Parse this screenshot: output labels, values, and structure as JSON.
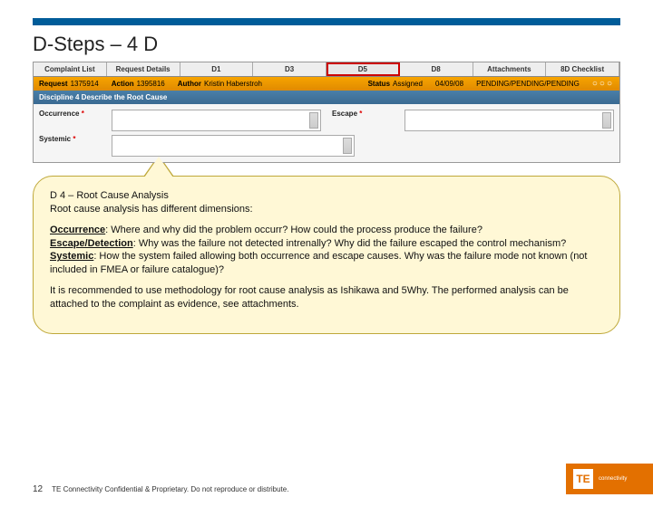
{
  "title": "D-Steps – 4 D",
  "tabs": [
    "Complaint List",
    "Request Details",
    "D1",
    "D3",
    "D5",
    "D8",
    "Attachments",
    "8D Checklist"
  ],
  "info": {
    "requestLabel": "Request",
    "requestVal": "1375914",
    "actionLabel": "Action",
    "actionVal": "1395816",
    "authorLabel": "Author",
    "authorVal": "Kristin Haberstroh",
    "statusLabel": "Status",
    "statusVal": "Assigned",
    "dateVal": "04/09/08",
    "pendVal": "PENDING/PENDING/PENDING"
  },
  "section": "Discipline 4    Describe the Root Cause",
  "fields": {
    "occurrence": "Occurrence",
    "escape": "Escape",
    "systemic": "Systemic",
    "req": "*"
  },
  "callout": {
    "line1": "D 4 – Root Cause Analysis",
    "line2": "Root cause analysis has different dimensions:",
    "occ": "Occurrence",
    "occTxt": ": Where and why did the problem occurr? How could the process produce the failure?",
    "esc": "Escape/Detection",
    "escTxt": ": Why was the failure not detected intrenally? Why did the failure escaped the control mechanism?",
    "sys": "Systemic",
    "sysTxt": ": How the system failed allowing both occurrence and escape causes. Why was the failure mode not known (not included in FMEA or failure catalogue)?",
    "rec": "It is recommended to use methodology for root cause analysis as Ishikawa and 5Why. The performed analysis can be attached to the complaint as evidence, see attachments."
  },
  "footer": {
    "page": "12",
    "conf": "TE Connectivity Confidential & Proprietary. Do not reproduce or distribute."
  },
  "logo": {
    "mark": "TE",
    "sub": "connectivity"
  }
}
